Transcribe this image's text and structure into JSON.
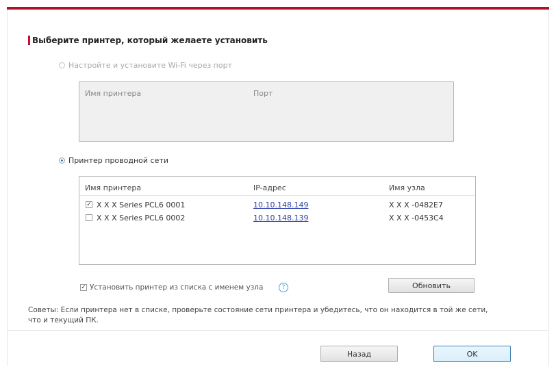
{
  "dialog": {
    "heading": "Выберите принтер, который желаете установить"
  },
  "wifi_option": {
    "label": "Настройте и установите Wi-Fi через порт",
    "selected": false,
    "enabled": false,
    "columns": [
      "Имя принтера",
      "Порт"
    ]
  },
  "wired_option": {
    "label": "Принтер проводной сети",
    "selected": true,
    "columns": [
      "Имя принтера",
      "IP-адрес",
      "Имя узла"
    ],
    "rows": [
      {
        "checked": true,
        "name": "X X X Series PCL6 0001",
        "ip": "10.10.148.149",
        "host": "X X X -0482E7"
      },
      {
        "checked": false,
        "name": "X X X Series PCL6 0002",
        "ip": "10.10.148.139",
        "host": "X X X -0453C4"
      }
    ]
  },
  "install_by_host": {
    "label": "Установить принтер из списка с именем узла",
    "checked": true
  },
  "buttons": {
    "refresh": "Обновить",
    "back": "Назад",
    "ok": "OK"
  },
  "tips": "Советы: Если принтера нет в списке, проверьте состояние сети принтера и убедитесь, что он находится в той же сети, что и текущий ПК.",
  "colors": {
    "accent": "#c8102e",
    "link": "#2a3fa8"
  }
}
